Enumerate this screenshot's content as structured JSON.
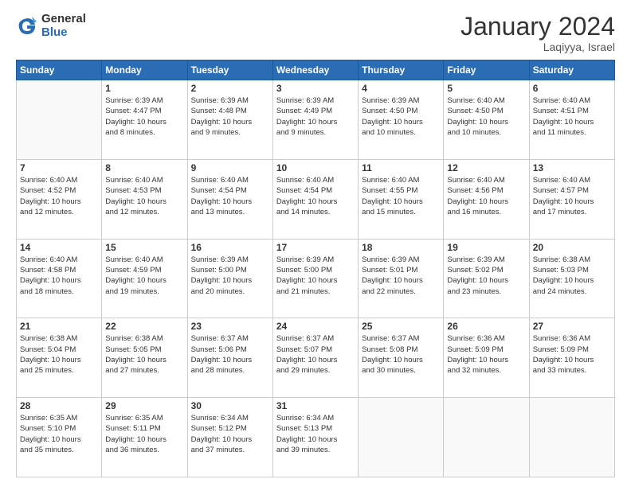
{
  "logo": {
    "general": "General",
    "blue": "Blue"
  },
  "title": "January 2024",
  "location": "Laqiyya, Israel",
  "days_header": [
    "Sunday",
    "Monday",
    "Tuesday",
    "Wednesday",
    "Thursday",
    "Friday",
    "Saturday"
  ],
  "weeks": [
    [
      {
        "num": "",
        "info": ""
      },
      {
        "num": "1",
        "info": "Sunrise: 6:39 AM\nSunset: 4:47 PM\nDaylight: 10 hours\nand 8 minutes."
      },
      {
        "num": "2",
        "info": "Sunrise: 6:39 AM\nSunset: 4:48 PM\nDaylight: 10 hours\nand 9 minutes."
      },
      {
        "num": "3",
        "info": "Sunrise: 6:39 AM\nSunset: 4:49 PM\nDaylight: 10 hours\nand 9 minutes."
      },
      {
        "num": "4",
        "info": "Sunrise: 6:39 AM\nSunset: 4:50 PM\nDaylight: 10 hours\nand 10 minutes."
      },
      {
        "num": "5",
        "info": "Sunrise: 6:40 AM\nSunset: 4:50 PM\nDaylight: 10 hours\nand 10 minutes."
      },
      {
        "num": "6",
        "info": "Sunrise: 6:40 AM\nSunset: 4:51 PM\nDaylight: 10 hours\nand 11 minutes."
      }
    ],
    [
      {
        "num": "7",
        "info": "Sunrise: 6:40 AM\nSunset: 4:52 PM\nDaylight: 10 hours\nand 12 minutes."
      },
      {
        "num": "8",
        "info": "Sunrise: 6:40 AM\nSunset: 4:53 PM\nDaylight: 10 hours\nand 12 minutes."
      },
      {
        "num": "9",
        "info": "Sunrise: 6:40 AM\nSunset: 4:54 PM\nDaylight: 10 hours\nand 13 minutes."
      },
      {
        "num": "10",
        "info": "Sunrise: 6:40 AM\nSunset: 4:54 PM\nDaylight: 10 hours\nand 14 minutes."
      },
      {
        "num": "11",
        "info": "Sunrise: 6:40 AM\nSunset: 4:55 PM\nDaylight: 10 hours\nand 15 minutes."
      },
      {
        "num": "12",
        "info": "Sunrise: 6:40 AM\nSunset: 4:56 PM\nDaylight: 10 hours\nand 16 minutes."
      },
      {
        "num": "13",
        "info": "Sunrise: 6:40 AM\nSunset: 4:57 PM\nDaylight: 10 hours\nand 17 minutes."
      }
    ],
    [
      {
        "num": "14",
        "info": "Sunrise: 6:40 AM\nSunset: 4:58 PM\nDaylight: 10 hours\nand 18 minutes."
      },
      {
        "num": "15",
        "info": "Sunrise: 6:40 AM\nSunset: 4:59 PM\nDaylight: 10 hours\nand 19 minutes."
      },
      {
        "num": "16",
        "info": "Sunrise: 6:39 AM\nSunset: 5:00 PM\nDaylight: 10 hours\nand 20 minutes."
      },
      {
        "num": "17",
        "info": "Sunrise: 6:39 AM\nSunset: 5:00 PM\nDaylight: 10 hours\nand 21 minutes."
      },
      {
        "num": "18",
        "info": "Sunrise: 6:39 AM\nSunset: 5:01 PM\nDaylight: 10 hours\nand 22 minutes."
      },
      {
        "num": "19",
        "info": "Sunrise: 6:39 AM\nSunset: 5:02 PM\nDaylight: 10 hours\nand 23 minutes."
      },
      {
        "num": "20",
        "info": "Sunrise: 6:38 AM\nSunset: 5:03 PM\nDaylight: 10 hours\nand 24 minutes."
      }
    ],
    [
      {
        "num": "21",
        "info": "Sunrise: 6:38 AM\nSunset: 5:04 PM\nDaylight: 10 hours\nand 25 minutes."
      },
      {
        "num": "22",
        "info": "Sunrise: 6:38 AM\nSunset: 5:05 PM\nDaylight: 10 hours\nand 27 minutes."
      },
      {
        "num": "23",
        "info": "Sunrise: 6:37 AM\nSunset: 5:06 PM\nDaylight: 10 hours\nand 28 minutes."
      },
      {
        "num": "24",
        "info": "Sunrise: 6:37 AM\nSunset: 5:07 PM\nDaylight: 10 hours\nand 29 minutes."
      },
      {
        "num": "25",
        "info": "Sunrise: 6:37 AM\nSunset: 5:08 PM\nDaylight: 10 hours\nand 30 minutes."
      },
      {
        "num": "26",
        "info": "Sunrise: 6:36 AM\nSunset: 5:09 PM\nDaylight: 10 hours\nand 32 minutes."
      },
      {
        "num": "27",
        "info": "Sunrise: 6:36 AM\nSunset: 5:09 PM\nDaylight: 10 hours\nand 33 minutes."
      }
    ],
    [
      {
        "num": "28",
        "info": "Sunrise: 6:35 AM\nSunset: 5:10 PM\nDaylight: 10 hours\nand 35 minutes."
      },
      {
        "num": "29",
        "info": "Sunrise: 6:35 AM\nSunset: 5:11 PM\nDaylight: 10 hours\nand 36 minutes."
      },
      {
        "num": "30",
        "info": "Sunrise: 6:34 AM\nSunset: 5:12 PM\nDaylight: 10 hours\nand 37 minutes."
      },
      {
        "num": "31",
        "info": "Sunrise: 6:34 AM\nSunset: 5:13 PM\nDaylight: 10 hours\nand 39 minutes."
      },
      {
        "num": "",
        "info": ""
      },
      {
        "num": "",
        "info": ""
      },
      {
        "num": "",
        "info": ""
      }
    ]
  ]
}
